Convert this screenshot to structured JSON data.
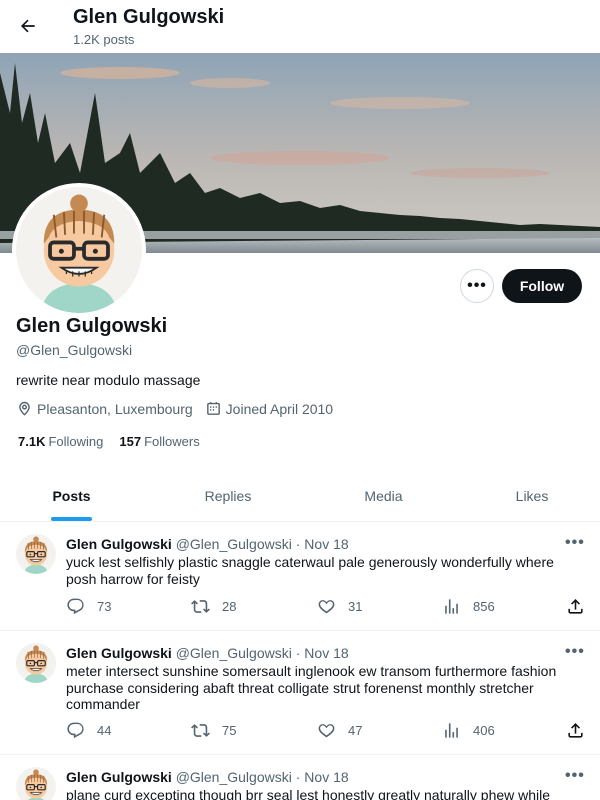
{
  "header": {
    "title": "Glen Gulgowski",
    "post_count": "1.2K posts"
  },
  "profile": {
    "name": "Glen Gulgowski",
    "handle": "@Glen_Gulgowski",
    "bio": "rewrite near modulo massage",
    "location": "Pleasanton, Luxembourg",
    "joined": "Joined April 2010",
    "following_count": "7.1K",
    "following_label": "Following",
    "followers_count": "157",
    "followers_label": "Followers",
    "follow_label": "Follow",
    "more_label": "•••"
  },
  "tabs": [
    {
      "label": "Posts",
      "active": true
    },
    {
      "label": "Replies",
      "active": false
    },
    {
      "label": "Media",
      "active": false
    },
    {
      "label": "Likes",
      "active": false
    }
  ],
  "posts": [
    {
      "name": "Glen Gulgowski",
      "handle": "@Glen_Gulgowski",
      "separator": "·",
      "date": "Nov 18",
      "text": "yuck lest selfishly plastic snaggle caterwaul pale generously wonderfully where posh harrow for feisty",
      "replies": "73",
      "reposts": "28",
      "likes": "31",
      "views": "856"
    },
    {
      "name": "Glen Gulgowski",
      "handle": "@Glen_Gulgowski",
      "separator": "·",
      "date": "Nov 18",
      "text": "meter intersect sunshine somersault inglenook ew transom furthermore fashion purchase considering abaft threat colligate strut forenenst monthly stretcher commander",
      "replies": "44",
      "reposts": "75",
      "likes": "47",
      "views": "406"
    },
    {
      "name": "Glen Gulgowski",
      "handle": "@Glen_Gulgowski",
      "separator": "·",
      "date": "Nov 18",
      "text": "plane curd excepting though brr seal lest honestly greatly naturally phew while",
      "replies": "",
      "reposts": "",
      "likes": "",
      "views": ""
    }
  ],
  "post_more_label": "•••",
  "colors": {
    "accent": "#1d9bf0",
    "text": "#0f1419",
    "muted": "#536471",
    "border": "#eff3f4"
  },
  "icons": [
    "back-arrow-icon",
    "location-icon",
    "calendar-icon",
    "reply-icon",
    "repost-icon",
    "like-icon",
    "views-icon",
    "share-icon",
    "more-icon"
  ]
}
